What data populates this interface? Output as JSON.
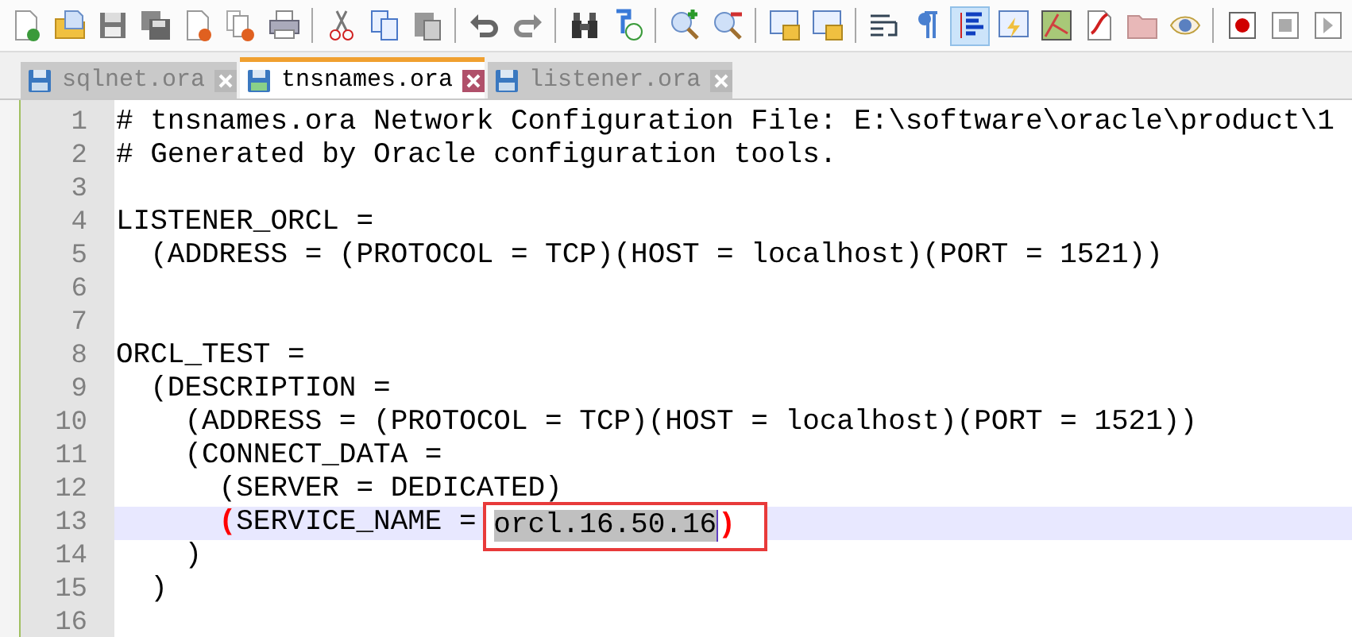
{
  "toolbar": [
    {
      "kind": "new",
      "pressed": false
    },
    {
      "kind": "open",
      "pressed": false
    },
    {
      "kind": "save",
      "pressed": false
    },
    {
      "kind": "save-all",
      "pressed": false
    },
    {
      "kind": "close",
      "pressed": false
    },
    {
      "kind": "close-all",
      "pressed": false
    },
    {
      "kind": "print",
      "pressed": false
    },
    {
      "kind": "separator"
    },
    {
      "kind": "cut",
      "pressed": false
    },
    {
      "kind": "copy",
      "pressed": false
    },
    {
      "kind": "paste",
      "pressed": false
    },
    {
      "kind": "separator"
    },
    {
      "kind": "undo",
      "pressed": false
    },
    {
      "kind": "redo",
      "pressed": false
    },
    {
      "kind": "separator"
    },
    {
      "kind": "find",
      "pressed": false
    },
    {
      "kind": "replace",
      "pressed": false
    },
    {
      "kind": "separator"
    },
    {
      "kind": "zoom-in",
      "pressed": false
    },
    {
      "kind": "zoom-out",
      "pressed": false
    },
    {
      "kind": "separator"
    },
    {
      "kind": "sync-v",
      "pressed": false
    },
    {
      "kind": "sync-h",
      "pressed": false
    },
    {
      "kind": "separator"
    },
    {
      "kind": "wrap",
      "pressed": false
    },
    {
      "kind": "all-chars",
      "pressed": false
    },
    {
      "kind": "indent-guide",
      "pressed": true
    },
    {
      "kind": "language",
      "pressed": false
    },
    {
      "kind": "doc-map",
      "pressed": false
    },
    {
      "kind": "function-list",
      "pressed": false
    },
    {
      "kind": "folder",
      "pressed": false
    },
    {
      "kind": "monitor",
      "pressed": false
    },
    {
      "kind": "separator"
    },
    {
      "kind": "record",
      "pressed": false
    },
    {
      "kind": "stop",
      "pressed": false
    },
    {
      "kind": "play",
      "pressed": false
    }
  ],
  "tabs": [
    {
      "label": "sqlnet.ora",
      "selected": false
    },
    {
      "label": "tnsnames.ora",
      "selected": true
    },
    {
      "label": "listener.ora",
      "selected": false
    }
  ],
  "editor": {
    "lines": [
      {
        "number": "1",
        "current": false,
        "segments": [
          {
            "kind": "plain",
            "text": "# tnsnames.ora Network Configuration File: E:\\software\\oracle\\product\\1"
          }
        ]
      },
      {
        "number": "2",
        "current": false,
        "segments": [
          {
            "kind": "plain",
            "text": "# Generated by Oracle configuration tools."
          }
        ]
      },
      {
        "number": "3",
        "current": false
      },
      {
        "number": "4",
        "current": false,
        "segments": [
          {
            "kind": "plain",
            "text": "LISTENER_ORCL ="
          }
        ]
      },
      {
        "number": "5",
        "current": false,
        "segments": [
          {
            "kind": "plain",
            "text": "  (ADDRESS = (PROTOCOL = TCP)(HOST = localhost)(PORT = 1521))"
          }
        ]
      },
      {
        "number": "6",
        "current": false
      },
      {
        "number": "7",
        "current": false
      },
      {
        "number": "8",
        "current": false,
        "segments": [
          {
            "kind": "plain",
            "text": "ORCL_TEST ="
          }
        ]
      },
      {
        "number": "9",
        "current": false,
        "segments": [
          {
            "kind": "plain",
            "text": "  (DESCRIPTION ="
          }
        ]
      },
      {
        "number": "10",
        "current": false,
        "segments": [
          {
            "kind": "plain",
            "text": "    (ADDRESS = (PROTOCOL = TCP)(HOST = localhost)(PORT = 1521))"
          }
        ]
      },
      {
        "number": "11",
        "current": false,
        "segments": [
          {
            "kind": "plain",
            "text": "    (CONNECT_DATA ="
          }
        ]
      },
      {
        "number": "12",
        "current": false,
        "segments": [
          {
            "kind": "plain",
            "text": "      (SERVER = DEDICATED)"
          }
        ]
      },
      {
        "number": "13",
        "current": true,
        "segments": [
          {
            "kind": "brace",
            "text": "("
          },
          {
            "kind": "plain",
            "text": "SERVICE_NAME = "
          },
          {
            "kind": "selection",
            "text": "orcl.16.50.16",
            "boxed": true
          },
          {
            "kind": "brace",
            "text": ")",
            "boxed": true
          }
        ]
      },
      {
        "number": "14",
        "current": false,
        "segments": [
          {
            "kind": "plain",
            "text": "    )"
          }
        ]
      },
      {
        "number": "15",
        "current": false,
        "segments": [
          {
            "kind": "plain",
            "text": "  )"
          }
        ]
      },
      {
        "number": "16",
        "current": false
      }
    ]
  }
}
